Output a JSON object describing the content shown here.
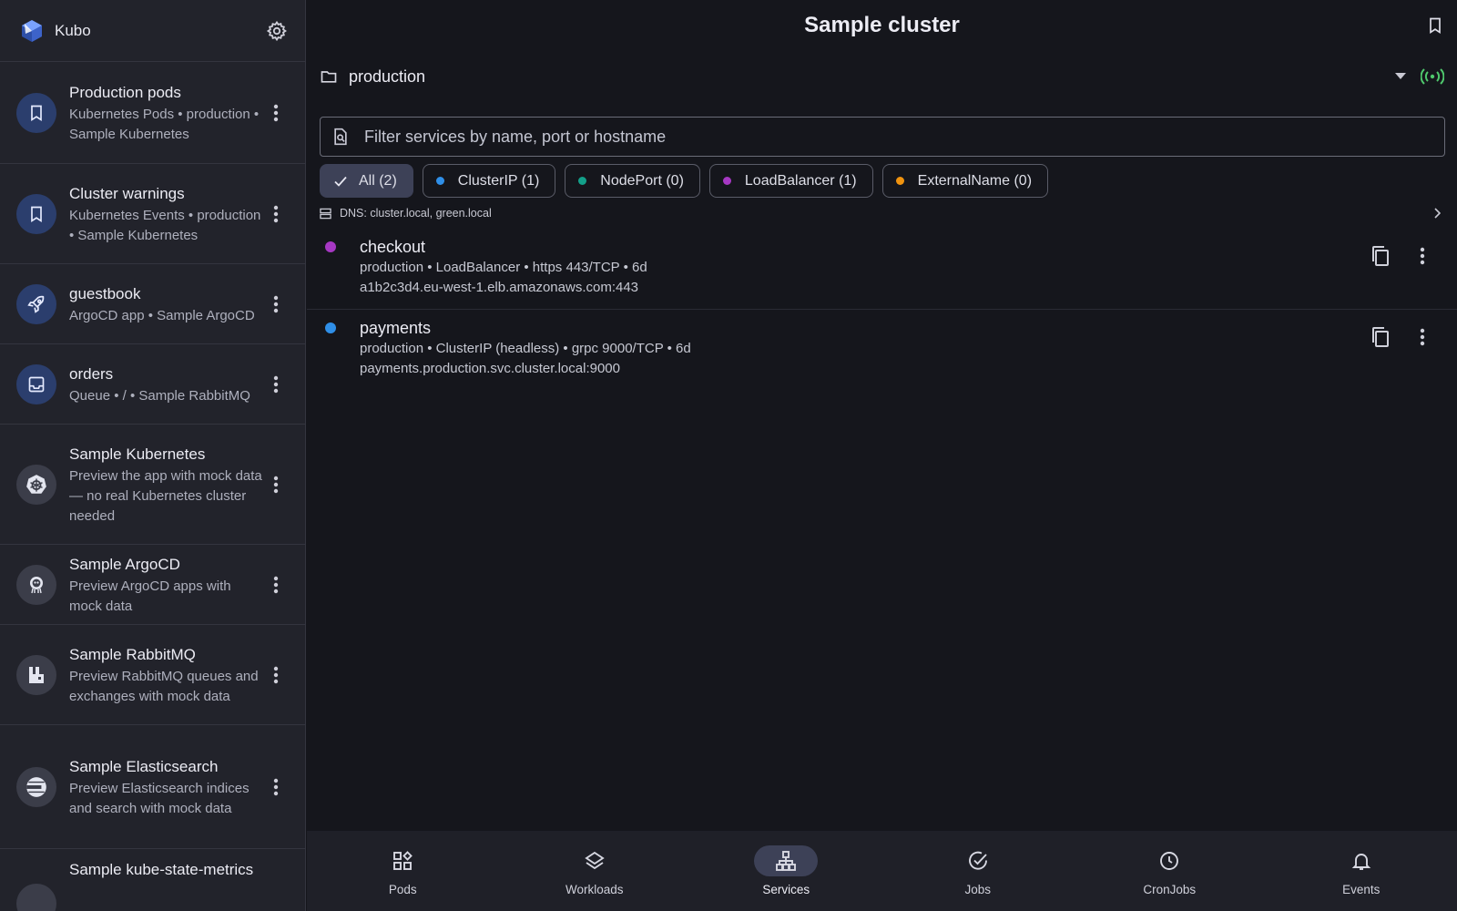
{
  "app": {
    "name": "Kubo"
  },
  "sidebar": {
    "items": [
      {
        "title": "Production pods",
        "subtitle": "Kubernetes Pods • production • Sample Kubernetes",
        "icon": "bookmark-icon"
      },
      {
        "title": "Cluster warnings",
        "subtitle": "Kubernetes Events • production • Sample Kubernetes",
        "icon": "bookmark-icon"
      },
      {
        "title": "guestbook",
        "subtitle": "ArgoCD app • Sample ArgoCD",
        "icon": "rocket-icon"
      },
      {
        "title": "orders",
        "subtitle": "Queue • / • Sample RabbitMQ",
        "icon": "inbox-icon"
      },
      {
        "title": "Sample Kubernetes",
        "subtitle": "Preview the app with mock data — no real Kubernetes cluster needed",
        "icon": "kubernetes-helm-icon"
      },
      {
        "title": "Sample ArgoCD",
        "subtitle": "Preview ArgoCD apps with mock data",
        "icon": "argocd-icon"
      },
      {
        "title": "Sample RabbitMQ",
        "subtitle": "Preview RabbitMQ queues and exchanges with mock data",
        "icon": "rabbitmq-icon"
      },
      {
        "title": "Sample Elasticsearch",
        "subtitle": "Preview Elasticsearch indices and search with mock data",
        "icon": "elasticsearch-icon"
      },
      {
        "title": "Sample kube-state-metrics",
        "subtitle": "",
        "icon": "metrics-icon"
      }
    ]
  },
  "header": {
    "title": "Sample cluster"
  },
  "namespace": {
    "value": "production"
  },
  "search": {
    "placeholder": "Filter services by name, port or hostname",
    "value": ""
  },
  "filters": [
    {
      "label": "All (2)",
      "selected": true,
      "color": ""
    },
    {
      "label": "ClusterIP (1)",
      "selected": false,
      "color": "#2f8fe8"
    },
    {
      "label": "NodePort (0)",
      "selected": false,
      "color": "#13a08a"
    },
    {
      "label": "LoadBalancer (1)",
      "selected": false,
      "color": "#a638c3"
    },
    {
      "label": "ExternalName (0)",
      "selected": false,
      "color": "#f0930f"
    }
  ],
  "dns": {
    "text": "DNS: cluster.local, green.local"
  },
  "services": [
    {
      "name": "checkout",
      "meta": "production • LoadBalancer • https 443/TCP • 6d",
      "host": "a1b2c3d4.eu-west-1.elb.amazonaws.com:443",
      "color": "#a638c3"
    },
    {
      "name": "payments",
      "meta": "production • ClusterIP (headless) • grpc 9000/TCP • 6d",
      "host": "payments.production.svc.cluster.local:9000",
      "color": "#2f8fe8"
    }
  ],
  "bottom_nav": {
    "items": [
      {
        "label": "Pods",
        "icon": "pods-grid-icon",
        "active": false
      },
      {
        "label": "Workloads",
        "icon": "layers-icon",
        "active": false
      },
      {
        "label": "Services",
        "icon": "network-tree-icon",
        "active": true
      },
      {
        "label": "Jobs",
        "icon": "check-circle-icon",
        "active": false
      },
      {
        "label": "CronJobs",
        "icon": "clock-icon",
        "active": false
      },
      {
        "label": "Events",
        "icon": "bell-icon",
        "active": false
      }
    ]
  },
  "colors": {
    "accent": "#3d4157",
    "live_status": "#4fc86d",
    "background": "#15161c",
    "sidebar_background": "#22232b"
  }
}
